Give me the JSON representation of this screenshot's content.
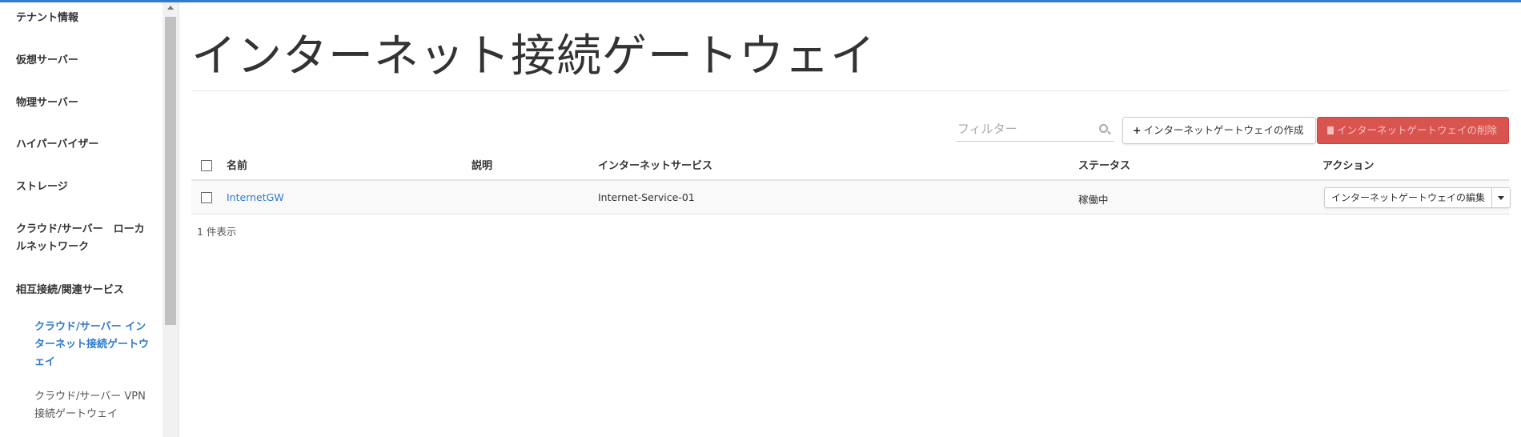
{
  "sidebar": {
    "items": [
      {
        "label": "テナント情報"
      },
      {
        "label": "仮想サーバー"
      },
      {
        "label": "物理サーバー"
      },
      {
        "label": "ハイパーバイザー"
      },
      {
        "label": "ストレージ"
      },
      {
        "label": "クラウド/サーバー　ローカ",
        "label2": "ルネットワーク"
      },
      {
        "label": "相互接続/関連サービス"
      }
    ],
    "subitems": [
      {
        "line1": "クラウド/サーバー イン",
        "line2": "ターネット接続ゲートウ",
        "line3": "ェイ"
      },
      {
        "line1": "クラウド/サーバー VPN",
        "line2": "接続ゲートウェイ"
      }
    ]
  },
  "main": {
    "title": "インターネット接続ゲートウェイ",
    "filter_placeholder": "フィルター",
    "create_button": "インターネットゲートウェイの作成",
    "delete_button": "インターネットゲートウェイの削除",
    "table": {
      "headers": [
        "名前",
        "説明",
        "インターネットサービス",
        "ステータス",
        "アクション"
      ],
      "rows": [
        {
          "name": "InternetGW",
          "description": "",
          "service": "Internet-Service-01",
          "status": "稼働中",
          "action": "インターネットゲートウェイの編集"
        }
      ]
    },
    "count_text": "1 件表示"
  },
  "colors": {
    "accent": "#2f7bd1",
    "danger": "#d9534f"
  }
}
